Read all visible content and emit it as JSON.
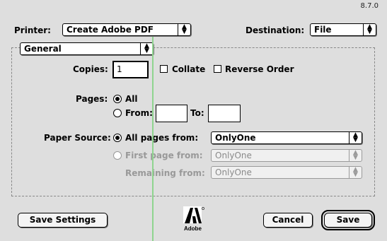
{
  "version": "8.7.0",
  "printer": {
    "label": "Printer:",
    "value": "Create Adobe PDF"
  },
  "destination": {
    "label": "Destination:",
    "value": "File"
  },
  "panel": {
    "value": "General"
  },
  "copies": {
    "label": "Copies:",
    "value": "1"
  },
  "collate_label": "Collate",
  "reverse_label": "Reverse Order",
  "pages": {
    "label": "Pages:",
    "all_label": "All",
    "from_label": "From:",
    "to_label": "To:",
    "from_value": "",
    "to_value": ""
  },
  "paper_source": {
    "label": "Paper Source:",
    "all_pages_label": "All pages from:",
    "all_pages_value": "OnlyOne",
    "first_page_label": "First page from:",
    "first_page_value": "OnlyOne",
    "remaining_label": "Remaining from:",
    "remaining_value": "OnlyOne"
  },
  "buttons": {
    "save_settings": "Save Settings",
    "cancel": "Cancel",
    "save": "Save"
  },
  "logo": {
    "brand": "Adobe",
    "color": "#000000"
  },
  "guide_color": "#8fd48f"
}
